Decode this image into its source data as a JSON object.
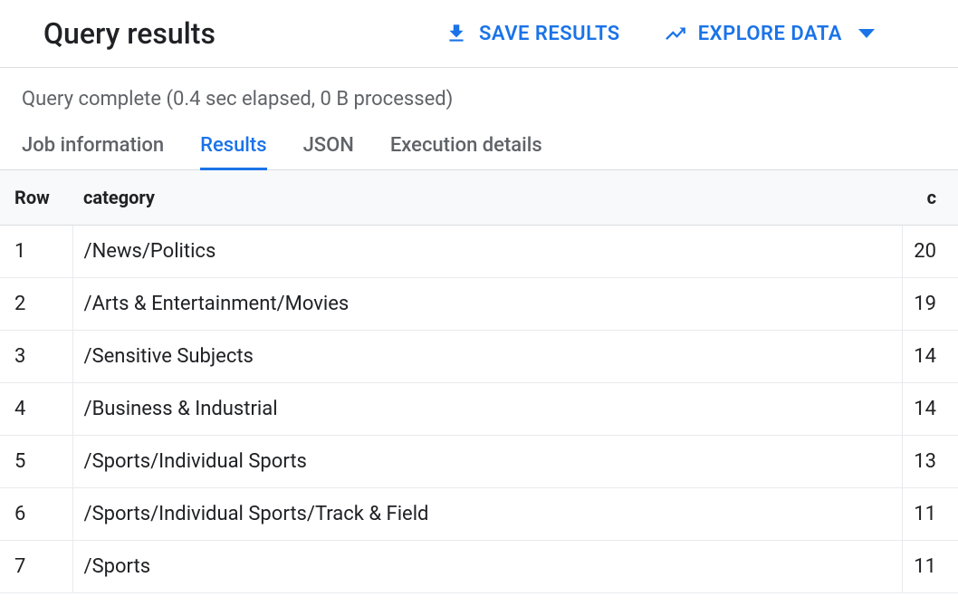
{
  "header": {
    "title": "Query results",
    "save_label": "SAVE RESULTS",
    "explore_label": "EXPLORE DATA"
  },
  "status": "Query complete (0.4 sec elapsed, 0 B processed)",
  "tabs": [
    {
      "label": "Job information",
      "active": false
    },
    {
      "label": "Results",
      "active": true
    },
    {
      "label": "JSON",
      "active": false
    },
    {
      "label": "Execution details",
      "active": false
    }
  ],
  "columns": {
    "row": "Row",
    "category": "category",
    "c": "c"
  },
  "rows": [
    {
      "row": "1",
      "category": "/News/Politics",
      "c": "20"
    },
    {
      "row": "2",
      "category": "/Arts & Entertainment/Movies",
      "c": "19"
    },
    {
      "row": "3",
      "category": "/Sensitive Subjects",
      "c": "14"
    },
    {
      "row": "4",
      "category": "/Business & Industrial",
      "c": "14"
    },
    {
      "row": "5",
      "category": "/Sports/Individual Sports",
      "c": "13"
    },
    {
      "row": "6",
      "category": "/Sports/Individual Sports/Track & Field",
      "c": "11"
    },
    {
      "row": "7",
      "category": "/Sports",
      "c": "11"
    }
  ]
}
